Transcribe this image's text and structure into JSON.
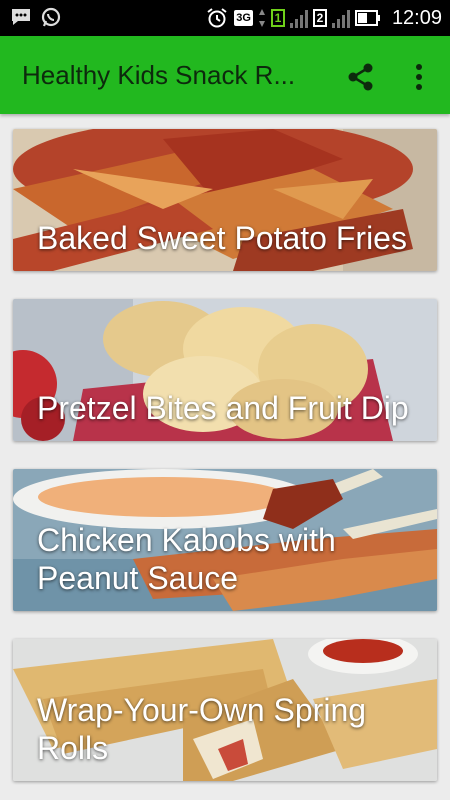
{
  "status_bar": {
    "time": "12:09",
    "network_type": "3G",
    "sim1_label": "1",
    "sim2_label": "2",
    "icons": [
      "message-icon",
      "whatsapp-icon",
      "alarm-icon",
      "network-3g-icon",
      "sim1-icon",
      "signal-icon",
      "sim2-icon",
      "signal-icon",
      "battery-icon"
    ]
  },
  "app_bar": {
    "title": "Healthy Kids Snack R...",
    "background": "#22b81f",
    "share_icon": "share-icon",
    "menu_icon": "more-vert-icon"
  },
  "recipes": [
    {
      "title": "Baked Sweet Potato Fries"
    },
    {
      "title": "Pretzel Bites and Fruit Dip"
    },
    {
      "title": "Chicken Kabobs with Peanut Sauce"
    },
    {
      "title": "Wrap-Your-Own Spring Rolls"
    }
  ]
}
